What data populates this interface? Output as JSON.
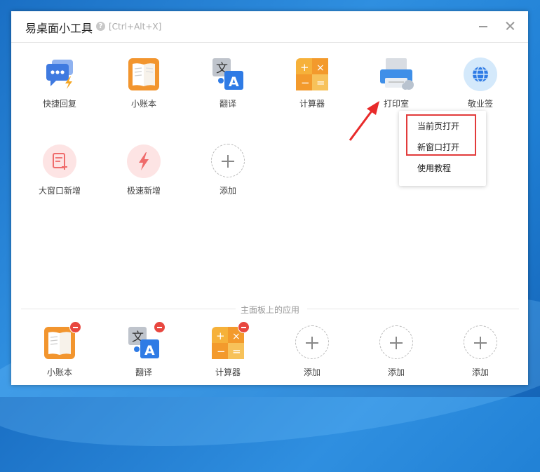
{
  "window": {
    "title": "易桌面小工具",
    "shortcut": "[Ctrl+Alt+X]"
  },
  "apps": [
    {
      "label": "快捷回复",
      "icon": "chat-reply-icon"
    },
    {
      "label": "小账本",
      "icon": "ledger-book-icon"
    },
    {
      "label": "翻译",
      "icon": "translate-icon"
    },
    {
      "label": "计算器",
      "icon": "calculator-icon"
    },
    {
      "label": "打印室",
      "icon": "printer-icon"
    },
    {
      "label": "敬业签",
      "icon": "globe-icon"
    },
    {
      "label": "大窗口新增",
      "icon": "note-add-icon"
    },
    {
      "label": "极速新增",
      "icon": "lightning-icon"
    },
    {
      "label": "添加",
      "icon": "add-icon"
    }
  ],
  "section_title": "主面板上的应用",
  "panel_apps": [
    {
      "label": "小账本",
      "icon": "ledger-book-icon"
    },
    {
      "label": "翻译",
      "icon": "translate-icon"
    },
    {
      "label": "计算器",
      "icon": "calculator-icon"
    },
    {
      "label": "添加",
      "icon": "add-icon"
    },
    {
      "label": "添加",
      "icon": "add-icon"
    },
    {
      "label": "添加",
      "icon": "add-icon"
    }
  ],
  "context_menu": {
    "items": [
      "当前页打开",
      "新窗口打开",
      "使用教程"
    ]
  },
  "colors": {
    "accent_blue": "#3a7bd5",
    "orange": "#f0a030",
    "highlight_red": "#e23b3b"
  }
}
